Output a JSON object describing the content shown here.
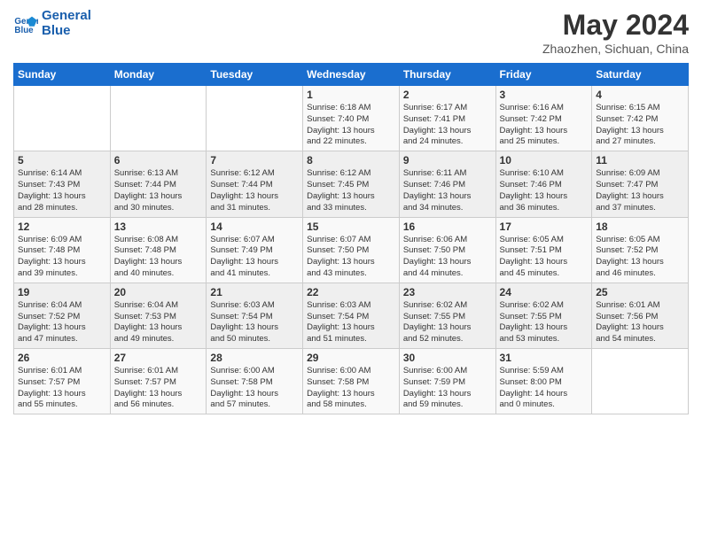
{
  "header": {
    "logo_line1": "General",
    "logo_line2": "Blue",
    "month_title": "May 2024",
    "location": "Zhaozhen, Sichuan, China"
  },
  "weekdays": [
    "Sunday",
    "Monday",
    "Tuesday",
    "Wednesday",
    "Thursday",
    "Friday",
    "Saturday"
  ],
  "weeks": [
    [
      {
        "day": "",
        "content": ""
      },
      {
        "day": "",
        "content": ""
      },
      {
        "day": "",
        "content": ""
      },
      {
        "day": "1",
        "content": "Sunrise: 6:18 AM\nSunset: 7:40 PM\nDaylight: 13 hours\nand 22 minutes."
      },
      {
        "day": "2",
        "content": "Sunrise: 6:17 AM\nSunset: 7:41 PM\nDaylight: 13 hours\nand 24 minutes."
      },
      {
        "day": "3",
        "content": "Sunrise: 6:16 AM\nSunset: 7:42 PM\nDaylight: 13 hours\nand 25 minutes."
      },
      {
        "day": "4",
        "content": "Sunrise: 6:15 AM\nSunset: 7:42 PM\nDaylight: 13 hours\nand 27 minutes."
      }
    ],
    [
      {
        "day": "5",
        "content": "Sunrise: 6:14 AM\nSunset: 7:43 PM\nDaylight: 13 hours\nand 28 minutes."
      },
      {
        "day": "6",
        "content": "Sunrise: 6:13 AM\nSunset: 7:44 PM\nDaylight: 13 hours\nand 30 minutes."
      },
      {
        "day": "7",
        "content": "Sunrise: 6:12 AM\nSunset: 7:44 PM\nDaylight: 13 hours\nand 31 minutes."
      },
      {
        "day": "8",
        "content": "Sunrise: 6:12 AM\nSunset: 7:45 PM\nDaylight: 13 hours\nand 33 minutes."
      },
      {
        "day": "9",
        "content": "Sunrise: 6:11 AM\nSunset: 7:46 PM\nDaylight: 13 hours\nand 34 minutes."
      },
      {
        "day": "10",
        "content": "Sunrise: 6:10 AM\nSunset: 7:46 PM\nDaylight: 13 hours\nand 36 minutes."
      },
      {
        "day": "11",
        "content": "Sunrise: 6:09 AM\nSunset: 7:47 PM\nDaylight: 13 hours\nand 37 minutes."
      }
    ],
    [
      {
        "day": "12",
        "content": "Sunrise: 6:09 AM\nSunset: 7:48 PM\nDaylight: 13 hours\nand 39 minutes."
      },
      {
        "day": "13",
        "content": "Sunrise: 6:08 AM\nSunset: 7:48 PM\nDaylight: 13 hours\nand 40 minutes."
      },
      {
        "day": "14",
        "content": "Sunrise: 6:07 AM\nSunset: 7:49 PM\nDaylight: 13 hours\nand 41 minutes."
      },
      {
        "day": "15",
        "content": "Sunrise: 6:07 AM\nSunset: 7:50 PM\nDaylight: 13 hours\nand 43 minutes."
      },
      {
        "day": "16",
        "content": "Sunrise: 6:06 AM\nSunset: 7:50 PM\nDaylight: 13 hours\nand 44 minutes."
      },
      {
        "day": "17",
        "content": "Sunrise: 6:05 AM\nSunset: 7:51 PM\nDaylight: 13 hours\nand 45 minutes."
      },
      {
        "day": "18",
        "content": "Sunrise: 6:05 AM\nSunset: 7:52 PM\nDaylight: 13 hours\nand 46 minutes."
      }
    ],
    [
      {
        "day": "19",
        "content": "Sunrise: 6:04 AM\nSunset: 7:52 PM\nDaylight: 13 hours\nand 47 minutes."
      },
      {
        "day": "20",
        "content": "Sunrise: 6:04 AM\nSunset: 7:53 PM\nDaylight: 13 hours\nand 49 minutes."
      },
      {
        "day": "21",
        "content": "Sunrise: 6:03 AM\nSunset: 7:54 PM\nDaylight: 13 hours\nand 50 minutes."
      },
      {
        "day": "22",
        "content": "Sunrise: 6:03 AM\nSunset: 7:54 PM\nDaylight: 13 hours\nand 51 minutes."
      },
      {
        "day": "23",
        "content": "Sunrise: 6:02 AM\nSunset: 7:55 PM\nDaylight: 13 hours\nand 52 minutes."
      },
      {
        "day": "24",
        "content": "Sunrise: 6:02 AM\nSunset: 7:55 PM\nDaylight: 13 hours\nand 53 minutes."
      },
      {
        "day": "25",
        "content": "Sunrise: 6:01 AM\nSunset: 7:56 PM\nDaylight: 13 hours\nand 54 minutes."
      }
    ],
    [
      {
        "day": "26",
        "content": "Sunrise: 6:01 AM\nSunset: 7:57 PM\nDaylight: 13 hours\nand 55 minutes."
      },
      {
        "day": "27",
        "content": "Sunrise: 6:01 AM\nSunset: 7:57 PM\nDaylight: 13 hours\nand 56 minutes."
      },
      {
        "day": "28",
        "content": "Sunrise: 6:00 AM\nSunset: 7:58 PM\nDaylight: 13 hours\nand 57 minutes."
      },
      {
        "day": "29",
        "content": "Sunrise: 6:00 AM\nSunset: 7:58 PM\nDaylight: 13 hours\nand 58 minutes."
      },
      {
        "day": "30",
        "content": "Sunrise: 6:00 AM\nSunset: 7:59 PM\nDaylight: 13 hours\nand 59 minutes."
      },
      {
        "day": "31",
        "content": "Sunrise: 5:59 AM\nSunset: 8:00 PM\nDaylight: 14 hours\nand 0 minutes."
      },
      {
        "day": "",
        "content": ""
      }
    ]
  ]
}
